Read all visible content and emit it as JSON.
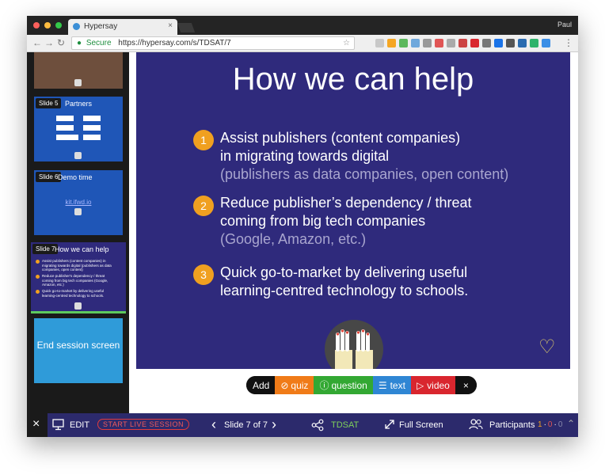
{
  "browser": {
    "tab_title": "Hypersay",
    "tab_close": "×",
    "user_name": "Paul",
    "secure_label": "Secure",
    "url": "https://hypersay.com/s/TDSAT/7",
    "back": "←",
    "forward": "→",
    "reload": "↻",
    "star": "☆",
    "menu": "⋮",
    "extensions": [
      "#c8c8c8",
      "#f5a623",
      "#5cb85c",
      "#6fa8dc",
      "#999999",
      "#e05555",
      "#aaaaaa",
      "#cc4444",
      "#d9262e",
      "#777777",
      "#1a73e8",
      "#555555",
      "#2b6cb0",
      "#2fb36b",
      "#3a8ee6"
    ]
  },
  "sidebar": {
    "slides": [
      {
        "label": "Slide 5",
        "title": "Partners"
      },
      {
        "label": "Slide 6",
        "title": "Demo time",
        "link": "kit.ifwd.io"
      },
      {
        "label": "Slide 7",
        "title": "How we can help",
        "items": [
          "Assist publishers (content companies) in migrating towards digital (publishers as data companies, open content)",
          "Reduce publisher's dependency / threat coming from big tech companies (Google, Amazon, etc.)",
          "Quick go-to-market by delivering useful learning-centred technology to schools."
        ]
      }
    ],
    "end_session": "End session screen"
  },
  "slide": {
    "title": "How we can help",
    "points": [
      {
        "num": "1",
        "line1": "Assist publishers (content companies)",
        "line2": "in migrating towards digital",
        "sub": "(publishers as data companies, open content)"
      },
      {
        "num": "2",
        "line1": "Reduce publisher’s dependency / threat",
        "line2": "coming from big tech companies",
        "sub": "(Google, Amazon, etc.)"
      },
      {
        "num": "3",
        "line1": "Quick go-to-market by delivering useful",
        "line2": "learning-centred technology to schools.",
        "sub": ""
      }
    ],
    "heart": "♡"
  },
  "addbar": {
    "add": "Add",
    "quiz": "quiz",
    "question": "question",
    "text": "text",
    "video": "video",
    "close": "×"
  },
  "bottom": {
    "close": "×",
    "edit": "EDIT",
    "live": "START LIVE SESSION",
    "prev": "‹",
    "slide_counter": "Slide 7 of 7",
    "next": "›",
    "session_code": "TDSAT",
    "fullscreen": "Full Screen",
    "participants": "Participants",
    "counts": [
      "1",
      "0",
      "0"
    ]
  },
  "colors": {
    "slide_bg": "#2f2a7c",
    "accent_orange": "#f0a020",
    "live_red": "#e23c3c",
    "session_green": "#7fd15a"
  }
}
